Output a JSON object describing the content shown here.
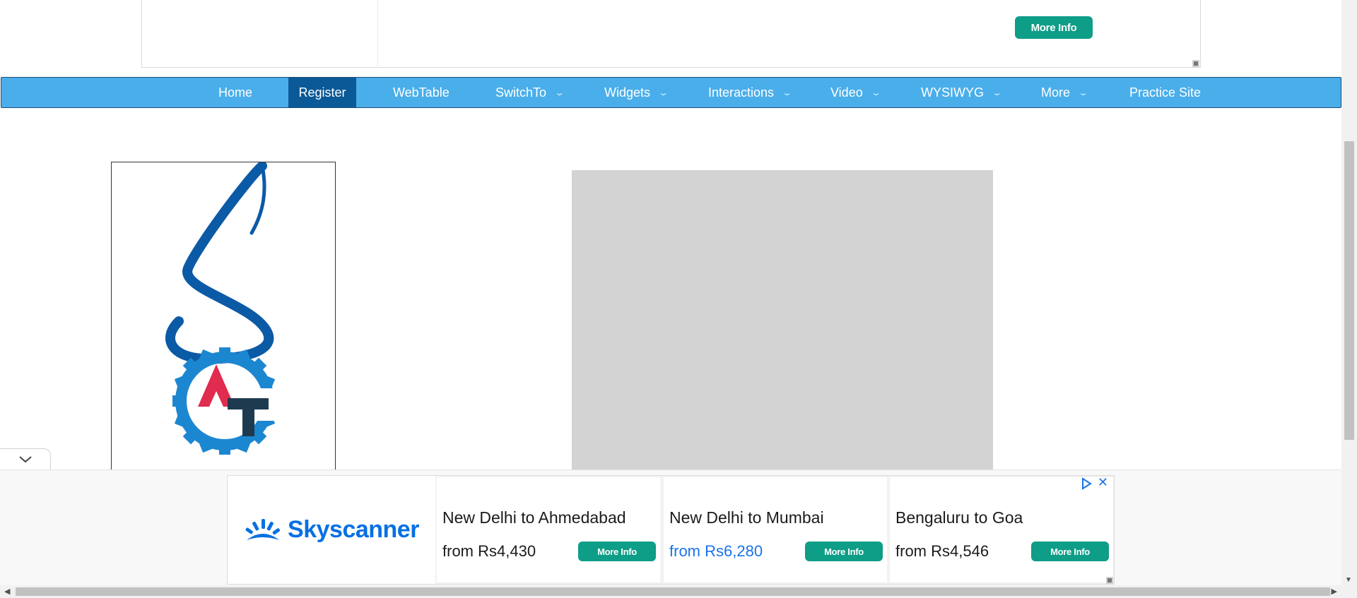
{
  "top_ad": {
    "more_info_label": "More Info"
  },
  "nav": {
    "items": [
      {
        "label": "Home"
      },
      {
        "label": "Register"
      },
      {
        "label": "WebTable"
      },
      {
        "label": "SwitchTo"
      },
      {
        "label": "Widgets"
      },
      {
        "label": "Interactions"
      },
      {
        "label": "Video"
      },
      {
        "label": "WYSIWYG"
      },
      {
        "label": "More"
      },
      {
        "label": "Practice Site"
      }
    ],
    "active": "Register"
  },
  "bottom_ad": {
    "brand": "Skyscanner",
    "cards": [
      {
        "route": "New Delhi to Ahmedabad",
        "price": "from Rs4,430",
        "button": "More Info"
      },
      {
        "route": "New Delhi to Mumbai",
        "price": "from Rs6,280",
        "button": "More Info"
      },
      {
        "route": "Bengaluru to Goa",
        "price": "from Rs4,546",
        "button": "More Info"
      }
    ],
    "close_glyph": "✕"
  },
  "colors": {
    "nav_bg": "#4aaeea",
    "nav_active": "#0b5996",
    "button_teal": "#0e9d87",
    "skyscanner_blue": "#0770e3",
    "logo_s_blue": "#0b5aa6",
    "logo_gear_blue": "#1c87d1",
    "logo_a_red": "#e12b4f",
    "logo_t_navy": "#1e3a4f"
  }
}
